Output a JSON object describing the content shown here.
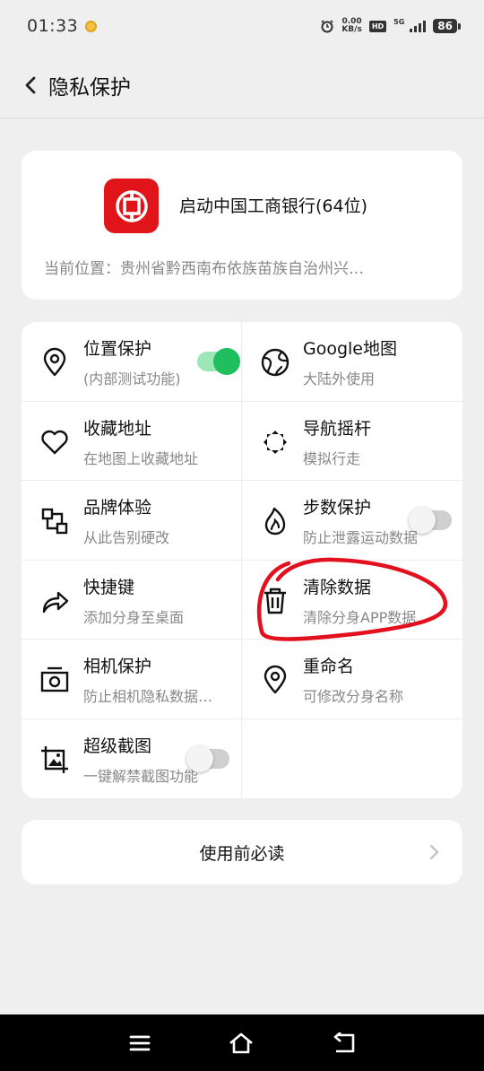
{
  "status_bar": {
    "time": "01:33",
    "net_speed_value": "0.00",
    "net_speed_unit": "KB/s",
    "hd_label": "HD",
    "network_type": "5G",
    "battery": "86"
  },
  "header": {
    "title": "隐私保护"
  },
  "launch_card": {
    "label": "启动中国工商银行(64位)",
    "location": "当前位置：贵州省黔西南布依族苗族自治州兴…"
  },
  "features": [
    {
      "title": "位置保护",
      "subtitle": "(内部测试功能)",
      "icon": "location-pin-icon",
      "toggle": true
    },
    {
      "title": "Google地图",
      "subtitle": "大陆外使用",
      "icon": "globe-icon"
    },
    {
      "title": "收藏地址",
      "subtitle": "在地图上收藏地址",
      "icon": "heart-icon"
    },
    {
      "title": "导航摇杆",
      "subtitle": "模拟行走",
      "icon": "move-arrows-icon",
      "toggle": false
    },
    {
      "title": "品牌体验",
      "subtitle": "从此告别硬改",
      "icon": "shapes-icon"
    },
    {
      "title": "步数保护",
      "subtitle": "防止泄露运动数据",
      "icon": "flame-icon"
    },
    {
      "title": "快捷键",
      "subtitle": "添加分身至桌面",
      "icon": "share-arrow-icon"
    },
    {
      "title": "清除数据",
      "subtitle": "清除分身APP数据",
      "icon": "trash-icon"
    },
    {
      "title": "相机保护",
      "subtitle": "防止相机隐私数据…",
      "icon": "camera-icon"
    },
    {
      "title": "重命名",
      "subtitle": "可修改分身名称",
      "icon": "location-pin-icon"
    },
    {
      "title": "超级截图",
      "subtitle": "一键解禁截图功能",
      "icon": "crop-image-icon",
      "toggle": false
    }
  ],
  "readme": {
    "label": "使用前必读"
  },
  "colors": {
    "accent_green": "#1fbf5f",
    "brand_red": "#e1141a",
    "annotation_red": "#e3101e",
    "background": "#efefef"
  }
}
